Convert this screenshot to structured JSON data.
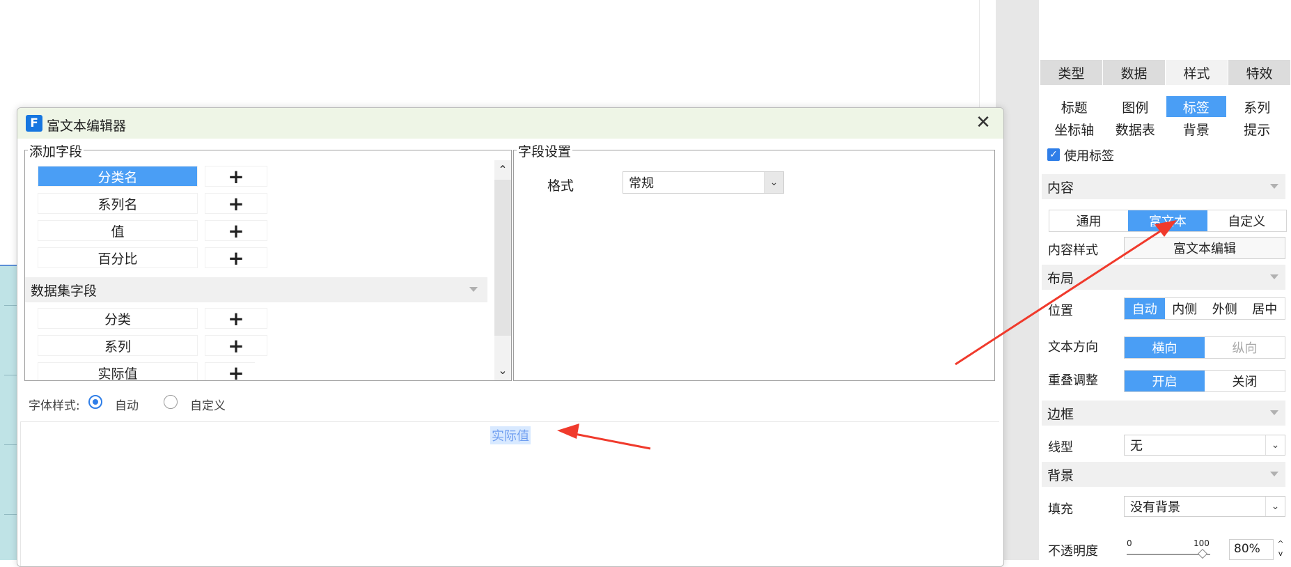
{
  "panel": {
    "tabs": [
      {
        "label": "类型"
      },
      {
        "label": "数据"
      },
      {
        "label": "样式"
      },
      {
        "label": "特效"
      }
    ],
    "subtabs": [
      {
        "label": "标题"
      },
      {
        "label": "图例"
      },
      {
        "label": "标签"
      },
      {
        "label": "系列"
      },
      {
        "label": "坐标轴"
      },
      {
        "label": "数据表"
      },
      {
        "label": "背景"
      },
      {
        "label": "提示"
      }
    ],
    "use_label": "使用标签",
    "content": {
      "section": "内容",
      "modes": [
        "通用",
        "富文本",
        "自定义"
      ],
      "style_label": "内容样式",
      "style_button": "富文本编辑"
    },
    "layout": {
      "section": "布局",
      "position_label": "位置",
      "positions": [
        "自动",
        "内侧",
        "外侧",
        "居中"
      ],
      "direction_label": "文本方向",
      "directions": [
        "横向",
        "纵向"
      ],
      "overlap_label": "重叠调整",
      "overlap": [
        "开启",
        "关闭"
      ]
    },
    "border": {
      "section": "边框",
      "line_label": "线型",
      "line_value": "无"
    },
    "background": {
      "section": "背景",
      "fill_label": "填充",
      "fill_value": "没有背景",
      "opacity_label": "不透明度",
      "slider_min": "0",
      "slider_max": "100",
      "opacity_value": "80%"
    }
  },
  "dialog": {
    "title": "富文本编辑器",
    "add_field_label": "添加字段",
    "fields": [
      {
        "label": "分类名"
      },
      {
        "label": "系列名"
      },
      {
        "label": "值"
      },
      {
        "label": "百分比"
      }
    ],
    "dataset_label": "数据集字段",
    "dataset_fields": [
      {
        "label": "分类"
      },
      {
        "label": "系列"
      },
      {
        "label": "实际值"
      }
    ],
    "add_symbol": "+",
    "field_settings_label": "字段设置",
    "format_label": "格式",
    "format_value": "常规",
    "font_style_label": "字体样式:",
    "font_auto": "自动",
    "font_custom": "自定义",
    "editor_text": "实际值"
  },
  "colors": {
    "accent": "#4a9ef5",
    "arrow": "#f03a2c"
  }
}
